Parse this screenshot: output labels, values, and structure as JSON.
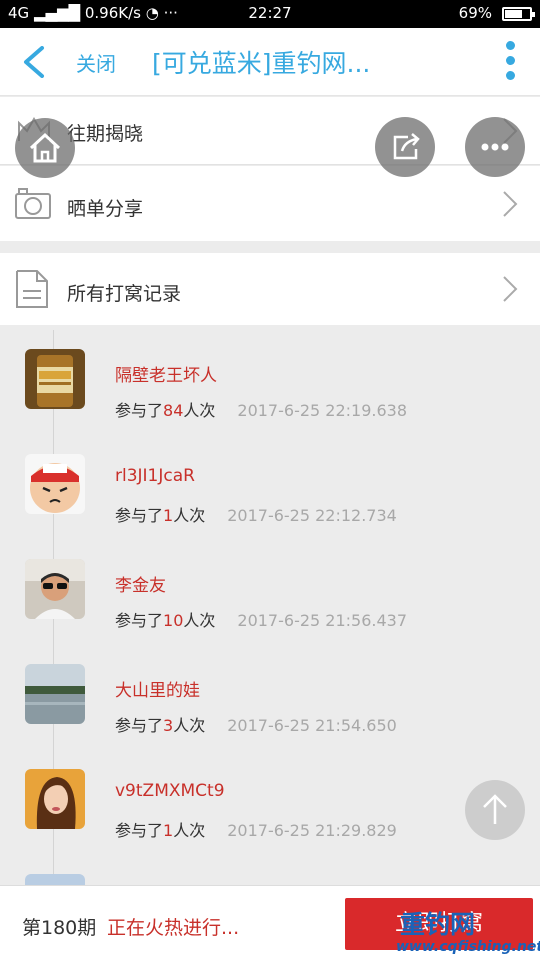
{
  "status_bar": {
    "network": "4G",
    "speed": "0.96K/s",
    "time": "22:27",
    "battery": "69%",
    "battery_level": 0.69
  },
  "nav": {
    "close_label": "关闭",
    "title": "[可兑蓝米]重钓网..."
  },
  "menu": {
    "history_label": "往期揭晓",
    "share_label": "晒单分享",
    "records_label": "所有打窝记录"
  },
  "records": [
    {
      "name": "隔壁老王坏人",
      "prefix": "参与了",
      "count": "84",
      "suffix": "人次",
      "time": "2017-6-25 22:19.638"
    },
    {
      "name": "rl3JI1JcaR",
      "prefix": "参与了",
      "count": "1",
      "suffix": "人次",
      "time": "2017-6-25 22:12.734"
    },
    {
      "name": "李金友",
      "prefix": "参与了",
      "count": "10",
      "suffix": "人次",
      "time": "2017-6-25 21:56.437"
    },
    {
      "name": "大山里的娃",
      "prefix": "参与了",
      "count": "3",
      "suffix": "人次",
      "time": "2017-6-25 21:54.650"
    },
    {
      "name": "v9tZMXMCt9",
      "prefix": "参与了",
      "count": "1",
      "suffix": "人次",
      "time": "2017-6-25 21:29.829"
    }
  ],
  "bottom": {
    "period": "第180期",
    "status": "正在火热进行...",
    "button_label": "立即打窝"
  },
  "watermark": {
    "main": "重钓网",
    "url": "www.cqfishing.net"
  },
  "colors": {
    "accent": "#37a9e0",
    "highlight_red": "#c8302a",
    "button_red": "#d9292b"
  }
}
